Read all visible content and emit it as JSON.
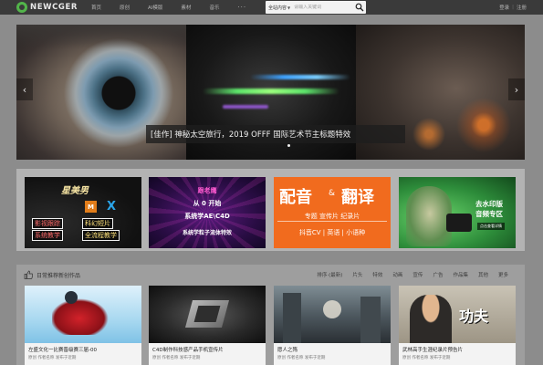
{
  "brand": {
    "name": "NEWCGER"
  },
  "nav": {
    "items": [
      "首页",
      "原创",
      "AI模版",
      "素材",
      "音乐"
    ],
    "more": "···"
  },
  "search": {
    "category": "全站内容",
    "placeholder": "请输入关键词"
  },
  "user": {
    "login": "登录",
    "register": "注册"
  },
  "hero": {
    "caption": "[佳作] 神秘太空旅行，2019 OFFF 国际艺术节主标题特效",
    "prev_arrow": "‹",
    "next_arrow": "›"
  },
  "promos": [
    {
      "title": "星美男",
      "badge": "M",
      "x_logo": "X",
      "tags": [
        "影视跟踪",
        "系统教学",
        "科幻短片",
        "全流程教学"
      ]
    },
    {
      "lines": [
        "跟老鹰",
        "从 0 开始",
        "系统学AE\\C4D",
        "系统学粒子流体特效"
      ]
    },
    {
      "title_a": "配音",
      "amp": "&",
      "title_b": "翻译",
      "line1": "专题 宣传片 纪录片",
      "line2": "抖音CV | 英语 | 小语种"
    },
    {
      "title1": "去水印版",
      "title2": "音频专区",
      "tag": "点击查看详情"
    }
  ],
  "recommend": {
    "title": "日常推荐新创作品",
    "filters": [
      "排序·(最新)",
      "片头",
      "特效",
      "动画",
      "宣传",
      "广告",
      "作品集",
      "其他",
      "更多"
    ],
    "cards": [
      {
        "title": "左盛文化一比赛晋级赛三届-00",
        "sub": "原创 作者名称 发布于近期"
      },
      {
        "title": "C4D制作科技感产品手机宣传片",
        "sub": "原创 作者名称 发布于近期"
      },
      {
        "title": "愿人之殇",
        "sub": "原创 作者名称 发布于近期"
      },
      {
        "title": "武林高手生涯纪录片预告片",
        "sub": "原创 作者名称 发布于近期",
        "overlay": "功夫"
      }
    ]
  },
  "colors": {
    "topbar": "#3a3a3a",
    "brand_green": "#52b44a",
    "promo_orange": "#f16b1e"
  }
}
